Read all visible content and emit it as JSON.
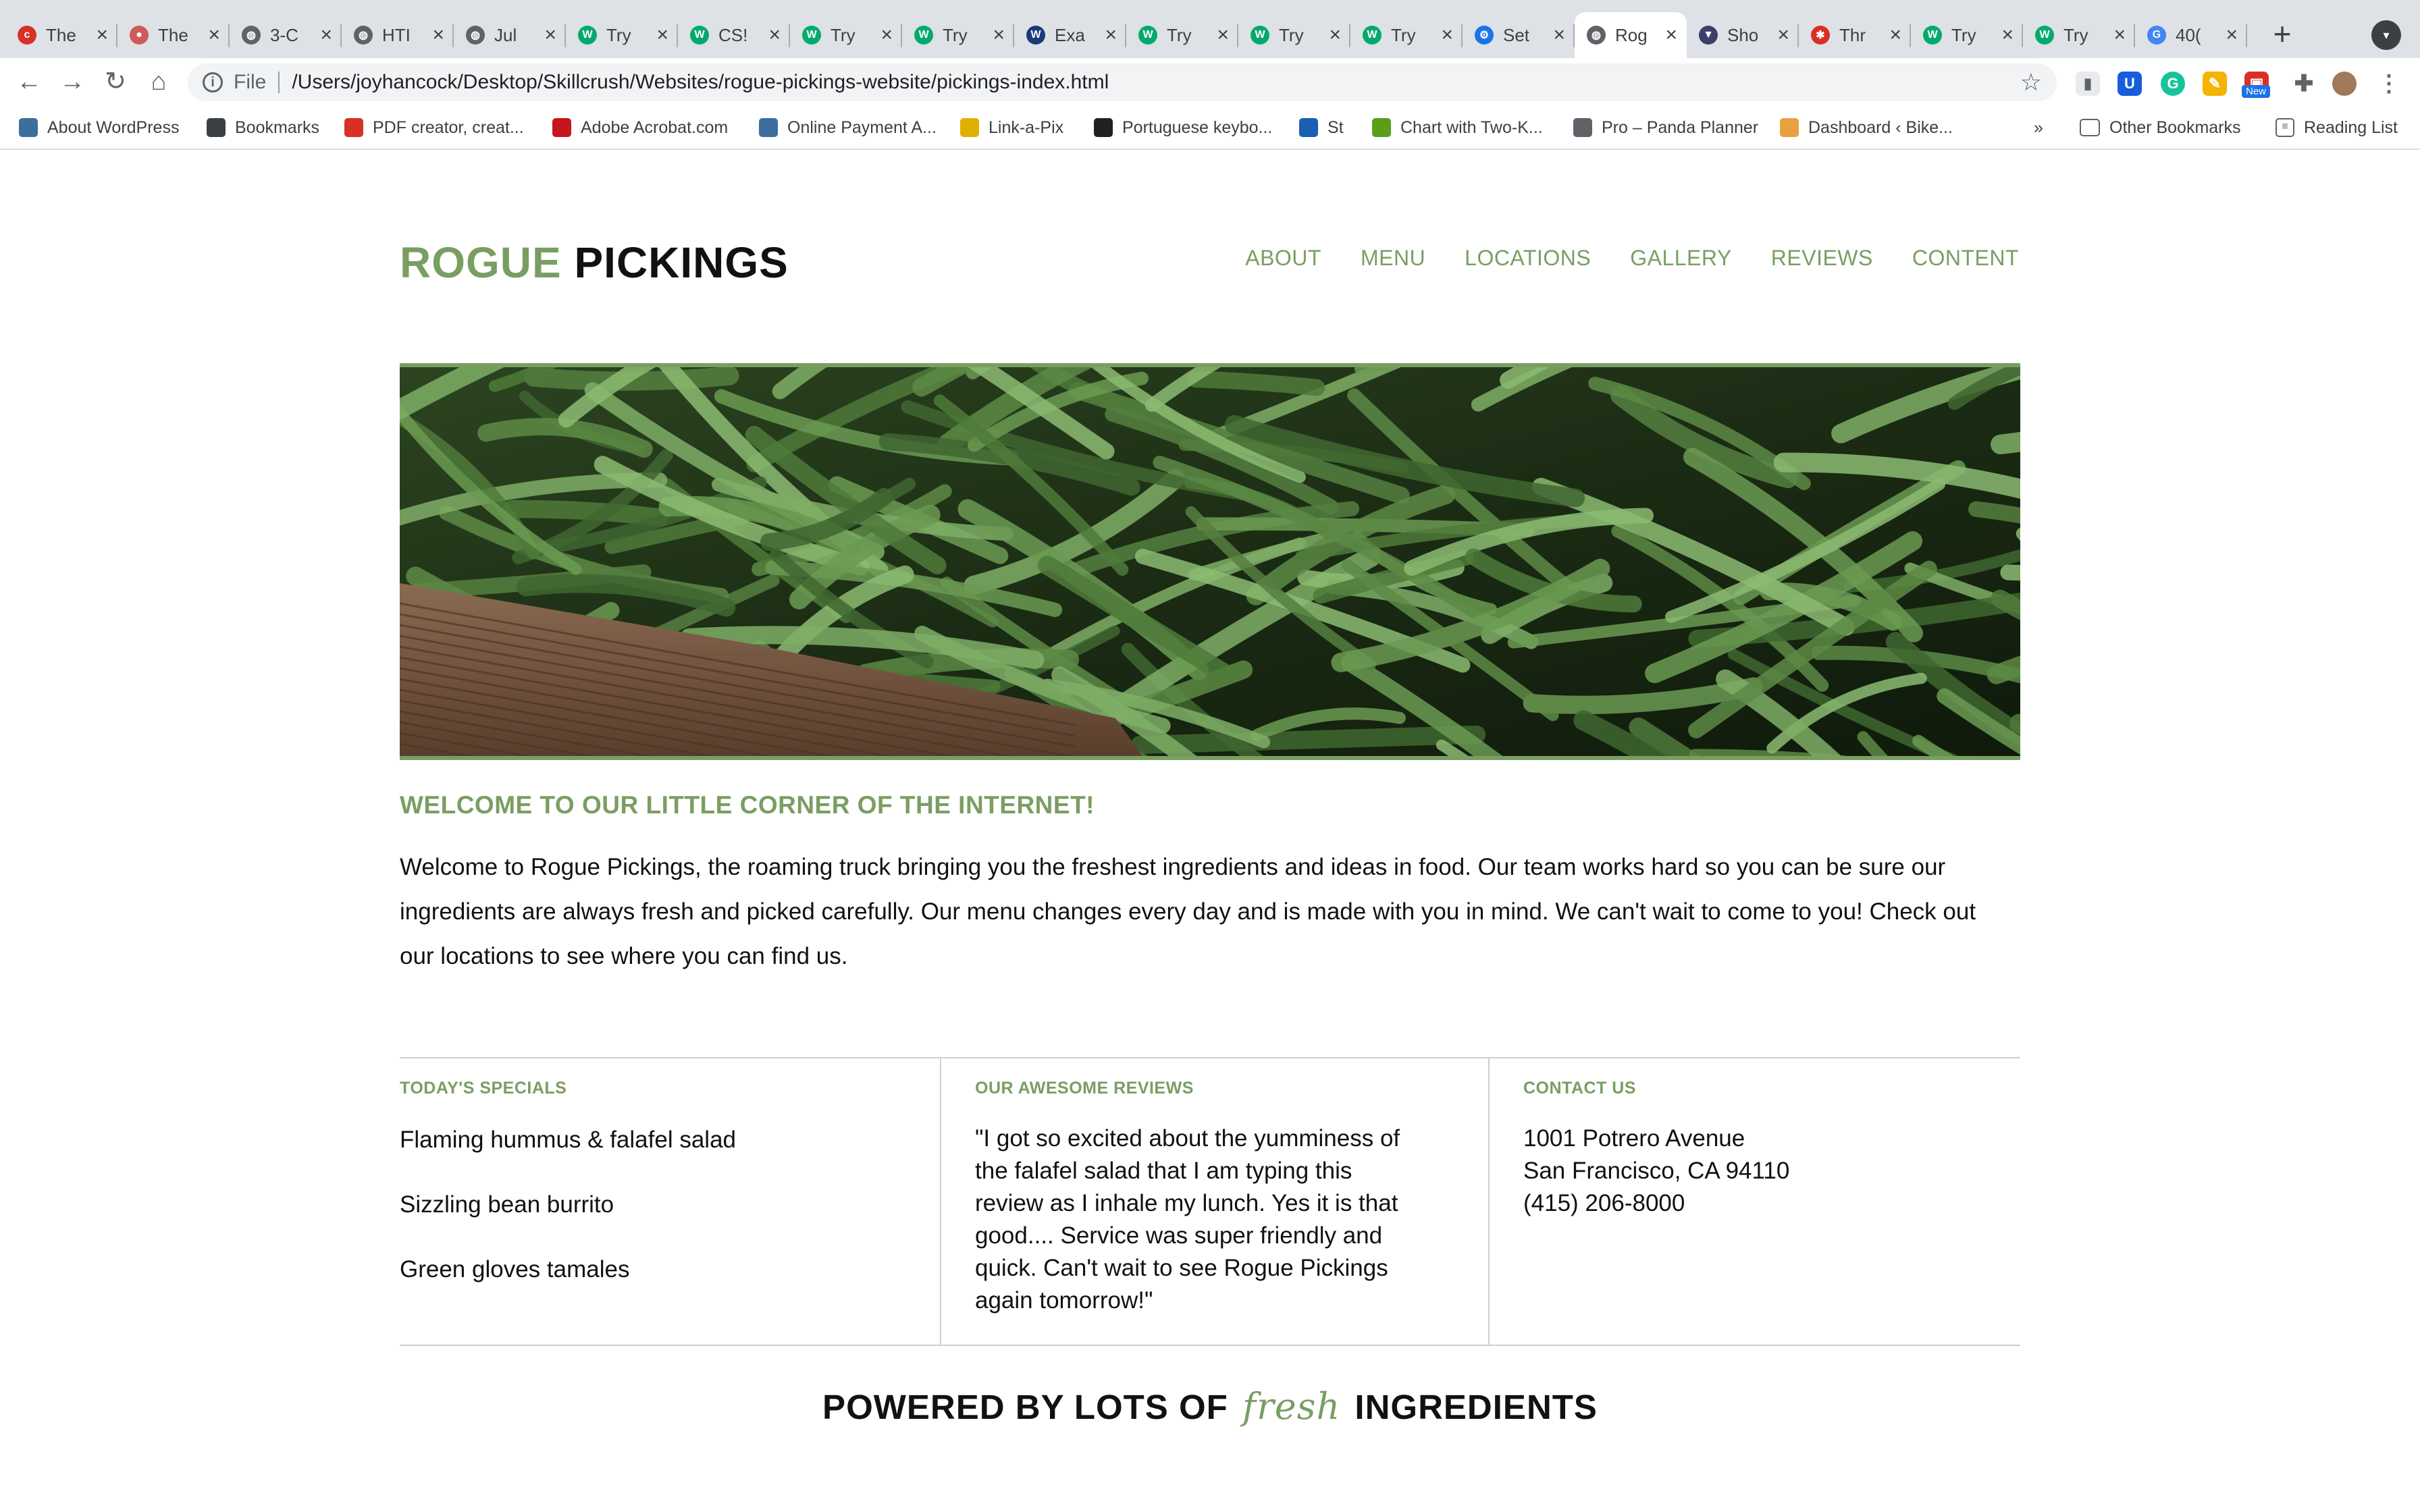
{
  "browser": {
    "tabs": [
      {
        "title": "The",
        "icon": "cnet-icon",
        "color": "#d93025",
        "glyph": "c"
      },
      {
        "title": "The",
        "icon": "circle-logo-icon",
        "color": "#d05a5a",
        "glyph": "●"
      },
      {
        "title": "3-C",
        "icon": "globe-icon",
        "color": "#5f6368",
        "glyph": "◍"
      },
      {
        "title": "HTI",
        "icon": "globe-icon",
        "color": "#5f6368",
        "glyph": "◍"
      },
      {
        "title": "Jul",
        "icon": "globe-icon",
        "color": "#5f6368",
        "glyph": "◍"
      },
      {
        "title": "Try",
        "icon": "w3schools-icon",
        "color": "#04aa6d",
        "glyph": "W"
      },
      {
        "title": "CS!",
        "icon": "w3schools-icon",
        "color": "#04aa6d",
        "glyph": "W"
      },
      {
        "title": "Try",
        "icon": "w3schools-icon",
        "color": "#04aa6d",
        "glyph": "W"
      },
      {
        "title": "Try",
        "icon": "w3schools-icon",
        "color": "#04aa6d",
        "glyph": "W"
      },
      {
        "title": "Exa",
        "icon": "w3-icon",
        "color": "#1a3a7a",
        "glyph": "W"
      },
      {
        "title": "Try",
        "icon": "w3schools-icon",
        "color": "#04aa6d",
        "glyph": "W"
      },
      {
        "title": "Try",
        "icon": "w3schools-icon",
        "color": "#04aa6d",
        "glyph": "W"
      },
      {
        "title": "Try",
        "icon": "w3schools-icon",
        "color": "#04aa6d",
        "glyph": "W"
      },
      {
        "title": "Set",
        "icon": "settings-gear-icon",
        "color": "#1a73e8",
        "glyph": "⚙"
      },
      {
        "title": "Rog",
        "icon": "globe-icon",
        "color": "#5f6368",
        "glyph": "◍",
        "active": true
      },
      {
        "title": "Sho",
        "icon": "fox-logo-icon",
        "color": "#3b3f6b",
        "glyph": "▼"
      },
      {
        "title": "Thr",
        "icon": "asterisk-icon",
        "color": "#d93025",
        "glyph": "✱"
      },
      {
        "title": "Try",
        "icon": "w3schools-icon",
        "color": "#04aa6d",
        "glyph": "W"
      },
      {
        "title": "Try",
        "icon": "w3schools-icon",
        "color": "#04aa6d",
        "glyph": "W"
      },
      {
        "title": "40(",
        "icon": "google-icon",
        "color": "#4285f4",
        "glyph": "G"
      }
    ],
    "address": {
      "scheme": "File",
      "url": "/Users/joyhancock/Desktop/Skillcrush/Websites/rogue-pickings-website/pickings-index.html"
    },
    "extension_badge": "New",
    "bookmarks": [
      {
        "label": "About WordPress",
        "icon": "wordpress-icon",
        "color": "#3c6e9e"
      },
      {
        "label": "Bookmarks",
        "icon": "star-icon",
        "color": "#3c4043"
      },
      {
        "label": "PDF creator, creat...",
        "icon": "pdf-icon",
        "color": "#d93025"
      },
      {
        "label": "Adobe Acrobat.com",
        "icon": "acrobat-icon",
        "color": "#c4161c"
      },
      {
        "label": "Online Payment A...",
        "icon": "payment-icon",
        "color": "#3c6e9e"
      },
      {
        "label": "Link-a-Pix",
        "icon": "link-a-pix-icon",
        "color": "#e0b000"
      },
      {
        "label": "Portuguese keybo...",
        "icon": "w-icon",
        "color": "#202124"
      },
      {
        "label": "St",
        "icon": "st-icon",
        "color": "#1a5fb4"
      },
      {
        "label": "Chart with Two-K...",
        "icon": "chart-icon",
        "color": "#5a9e1a"
      },
      {
        "label": "Pro – Panda Planner",
        "icon": "panda-icon",
        "color": "#5f6368"
      },
      {
        "label": "Dashboard ‹ Bike...",
        "icon": "bike-icon",
        "color": "#e8a040"
      }
    ],
    "bookmarks_overflow": "»",
    "other_bookmarks": "Other Bookmarks",
    "reading_list": "Reading List"
  },
  "site": {
    "logo": {
      "part1": "ROGUE",
      "part2": "PICKINGS"
    },
    "nav": [
      "ABOUT",
      "MENU",
      "LOCATIONS",
      "GALLERY",
      "REVIEWS",
      "CONTENT"
    ],
    "welcome": {
      "title": "WELCOME TO OUR LITTLE CORNER OF THE INTERNET!",
      "body": "Welcome to Rogue Pickings, the roaming truck bringing you the freshest ingredients and ideas in food. Our team works hard so you can be sure our ingredients are always fresh and picked carefully. Our menu changes every day and is made with you in mind. We can't wait to come to you! Check out our locations to see where you can find us."
    },
    "specials": {
      "title": "TODAY'S SPECIALS",
      "items": [
        "Flaming hummus & falafel salad",
        "Sizzling bean burrito",
        "Green gloves tamales"
      ]
    },
    "reviews": {
      "title": "OUR AWESOME REVIEWS",
      "text": "\"I got so excited about the yumminess of the falafel salad that I am typing this review as I inhale my lunch. Yes it is that good.... Service was super friendly and quick. Can't wait to see Rogue Pickings again tomorrow!\""
    },
    "contact": {
      "title": "CONTACT US",
      "lines": [
        "1001 Potrero Avenue",
        "San Francisco, CA 94110",
        "(415) 206-8000"
      ]
    },
    "footer": {
      "before": "POWERED BY LOTS OF",
      "fresh": "fresh",
      "after": "INGREDIENTS"
    },
    "accent_color": "#7a9e62"
  }
}
